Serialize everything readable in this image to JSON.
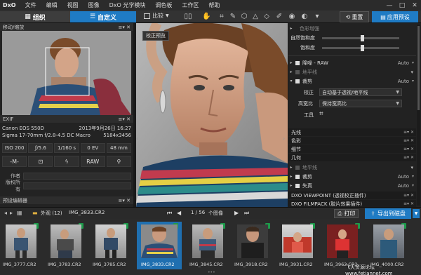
{
  "menu": {
    "logo": "DxO",
    "items": [
      "文件",
      "编辑",
      "视图",
      "图像",
      "DxO 光学模块",
      "调色板",
      "工作区",
      "帮助"
    ],
    "window_buttons": [
      "—",
      "□",
      "✕"
    ]
  },
  "toolbar": {
    "tab_organize": "组织",
    "tab_customize": "自定义",
    "compare_label": "比较",
    "reset_label": "重置",
    "apply_preset_label": "应用预设"
  },
  "left": {
    "navigator_title": "移动/缩放",
    "exif_title": "EXIF",
    "camera": "Canon EOS 550D",
    "date": "2013年9月26日 16:27",
    "lens": "Sigma 17-70mm f/2.8-4.5 DC Macro",
    "dimensions": "5184x3456",
    "exif_values": [
      "ISO 200",
      "ƒ/5.6",
      "1/160 s",
      "0 EV",
      "48 mm"
    ],
    "mode_values": [
      "-M-",
      "RAW"
    ],
    "author_label": "作者",
    "copyright_label": "版权所有",
    "preset_editor_title": "预设编辑器"
  },
  "viewer": {
    "tag_label": "校正预览"
  },
  "right": {
    "color_enhance_label": "色彩增强",
    "natural_saturation_label": "自然饱和度",
    "saturation_label": "饱和度",
    "denoise_label": "降噪 - RAW",
    "horizon_label": "地平线",
    "crop_label": "裁剪",
    "auto": "Auto",
    "correction_label": "校正",
    "correction_value": "自动基于透视/地平线",
    "aspect_label": "高宽比",
    "aspect_value": "保持宽高比",
    "tool_label": "工具",
    "sections": [
      "光线",
      "色彩",
      "细节",
      "几何"
    ],
    "horizon2_label": "地平线",
    "crop2_label": "裁剪",
    "distortion_label": "失真",
    "viewpoint_label": "DXO VIEWPOINT (透视校正插件)",
    "filmpack_label": "DXO FILMPACK (胶片效果插件)"
  },
  "filmbar": {
    "folder_label": "外观 (12)",
    "file_label": "IMG_3833.CR2",
    "page_info": "1 / 56",
    "images_label": "个图像",
    "print_label": "打印",
    "export_label": "导出到磁盘"
  },
  "thumbnails": [
    {
      "name": "IMG_3777.CR2",
      "selected": false
    },
    {
      "name": "IMG_3783.CR2",
      "selected": false
    },
    {
      "name": "IMG_3785.CR2",
      "selected": false
    },
    {
      "name": "IMG_3833.CR2",
      "selected": true
    },
    {
      "name": "IMG_3845.CR2",
      "selected": false
    },
    {
      "name": "IMG_3918.CR2",
      "selected": false
    },
    {
      "name": "IMG_3931.CR2",
      "selected": false
    },
    {
      "name": "IMG_3962.CR2",
      "selected": false
    },
    {
      "name": "IMG_4000.CR2",
      "selected": false
    }
  ],
  "watermark": "飞天资源论坛 www.fetiannet.com",
  "colors": {
    "accent": "#1f7bc4",
    "badge": "#1d9a4a"
  }
}
